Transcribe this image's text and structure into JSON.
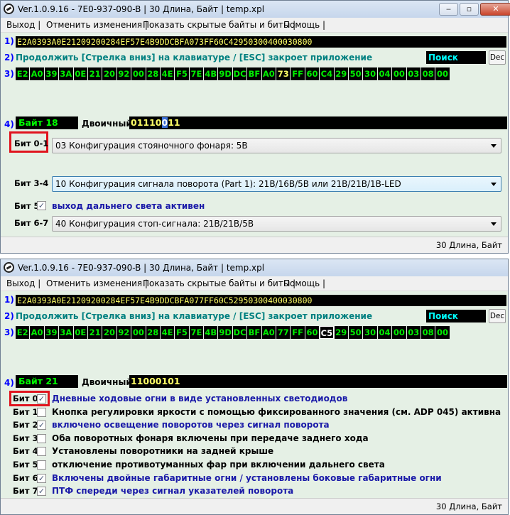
{
  "top": {
    "title": "Ver.1.0.9.16 -   7E0-937-090-B | 30 Длина, Байт | temp.xpl",
    "menu": [
      "Выход |",
      "Отменить изменения |",
      "Показать скрытые байты и биты |",
      "Помощь |"
    ],
    "rows": {
      "r1_num": "1)",
      "r2_num": "2)",
      "r3_num": "3)",
      "r4_num": "4)",
      "hex": "E2A0393A0E21209200284EF57E4B9DDCBFA073FF60C42950300400030800",
      "hint": "Продолжить [Стрелка вниз] на клавиатуре / [ESC] закроет приложение",
      "search": "Поиск",
      "dec": "Dec"
    },
    "bytes": [
      "E2",
      "A0",
      "39",
      "3A",
      "0E",
      "21",
      "20",
      "92",
      "00",
      "28",
      "4E",
      "F5",
      "7E",
      "4B",
      "9D",
      "DC",
      "BF",
      "A0",
      "73",
      "FF",
      "60",
      "C4",
      "29",
      "50",
      "30",
      "04",
      "00",
      "03",
      "08",
      "00"
    ],
    "selected_byte_index": 18,
    "byte_label": "Байт 18",
    "binary_label": "Двоичный:",
    "binary_value_pre": "01110",
    "binary_value_cur": "0",
    "binary_value_post": "11",
    "fields": [
      {
        "label": "Бит 0-1",
        "value": "03 Конфигурация стояночного фонаря: 5В"
      },
      {
        "label": "Бит 3-4",
        "value": "10 Конфигурация сигнала поворота (Part 1): 21В/16В/5В или 21В/21В/1В-LED"
      },
      {
        "label": "Бит 6-7",
        "value": "40 Конфигурация стоп-сигнала: 21В/21В/5В"
      }
    ],
    "bit5": {
      "label": "Бит 5",
      "checked": true,
      "check": "✓",
      "text": "выход дальнего света активен"
    },
    "status": "30 Длина, Байт"
  },
  "bottom": {
    "title": "Ver.1.0.9.16 -   7E0-937-090-B | 30 Длина, Байт | temp.xpl",
    "menu": [
      "Выход |",
      "Отменить изменения |",
      "Показать скрытые байты и биты |",
      "Помощь |"
    ],
    "rows": {
      "r1_num": "1)",
      "r2_num": "2)",
      "r3_num": "3)",
      "r4_num": "4)",
      "hex": "E2A0393A0E21209200284EF57E4B9DDCBFA077FF60C52950300400030800",
      "hint": "Продолжить [Стрелка вниз] на клавиатуре / [ESC] закроет приложение",
      "search": "Поиск",
      "dec": "Dec"
    },
    "bytes": [
      "E2",
      "A0",
      "39",
      "3A",
      "0E",
      "21",
      "20",
      "92",
      "00",
      "28",
      "4E",
      "F5",
      "7E",
      "4B",
      "9D",
      "DC",
      "BF",
      "A0",
      "77",
      "FF",
      "60",
      "C5",
      "29",
      "50",
      "30",
      "04",
      "00",
      "03",
      "08",
      "00"
    ],
    "selected_byte_index": 21,
    "byte_label": "Байт 21",
    "binary_label": "Двоичный:",
    "binary_value": "11000101",
    "bits": [
      {
        "label": "Бит 0",
        "checked": true,
        "check": "✓",
        "text": "Дневные ходовые огни в виде установленных светодиодов"
      },
      {
        "label": "Бит 1",
        "checked": false,
        "check": "",
        "text": "Кнопка регулировки яркости с помощью фиксированного значения (см. ADP 045) активна"
      },
      {
        "label": "Бит 2",
        "checked": true,
        "check": "✓",
        "text": "включено освещение поворотов через сигнал поворота"
      },
      {
        "label": "Бит 3",
        "checked": false,
        "check": "",
        "text": "Оба поворотных фонаря включены при передаче заднего хода"
      },
      {
        "label": "Бит 4",
        "checked": false,
        "check": "",
        "text": "Установлены поворотники на задней крыше"
      },
      {
        "label": "Бит 5",
        "checked": false,
        "check": "",
        "text": "отключение противотуманных фар при включении дальнего света"
      },
      {
        "label": "Бит 6",
        "checked": true,
        "check": "✓",
        "text": "Включены двойные габаритные огни / установлены боковые габаритные огни"
      },
      {
        "label": "Бит 7",
        "checked": true,
        "check": "✓",
        "text": "ПТФ спереди через сигнал указателей поворота"
      }
    ],
    "status": "30 Длина, Байт"
  },
  "colors": {
    "accent_red": "#e0141e",
    "byte_green": "#00ee00",
    "hex_yellow": "#ffff66",
    "search_cyan": "#00ffff",
    "checked_text_blue": "#1a1aa8"
  }
}
